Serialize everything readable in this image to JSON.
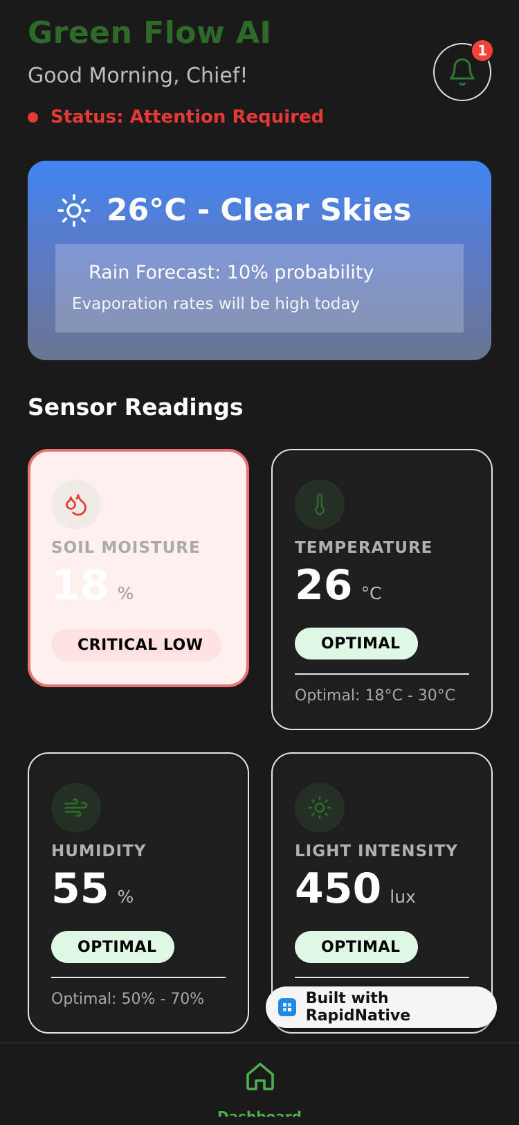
{
  "header": {
    "app_title": "Green Flow AI",
    "greeting": "Good Morning, Chief!",
    "status": "Status: Attention Required",
    "notification_count": "1"
  },
  "weather": {
    "title": "26°C - Clear Skies",
    "forecast": "Rain Forecast: 10% probability",
    "note": "Evaporation rates will be high today"
  },
  "sensors": {
    "section_title": "Sensor Readings",
    "items": [
      {
        "label": "SOIL MOISTURE",
        "value": "18",
        "unit": "%",
        "status": "CRITICAL LOW",
        "range": "",
        "icon": "droplets-icon"
      },
      {
        "label": "TEMPERATURE",
        "value": "26",
        "unit": "°C",
        "status": "OPTIMAL",
        "range": "Optimal: 18°C - 30°C",
        "icon": "thermometer-icon"
      },
      {
        "label": "HUMIDITY",
        "value": "55",
        "unit": "%",
        "status": "OPTIMAL",
        "range": "Optimal: 50% - 70%",
        "icon": "wind-icon"
      },
      {
        "label": "LIGHT INTENSITY",
        "value": "450",
        "unit": "lux",
        "status": "OPTIMAL",
        "range": "",
        "icon": "sun-icon"
      }
    ]
  },
  "built_with": "Built with RapidNative",
  "tabbar": {
    "home_label": "Dashboard"
  },
  "colors": {
    "brand_green": "#2e6b2a",
    "alert_red": "#e53935",
    "optimal_bg": "#dff8e6",
    "critical_bg": "#fff0f0"
  }
}
